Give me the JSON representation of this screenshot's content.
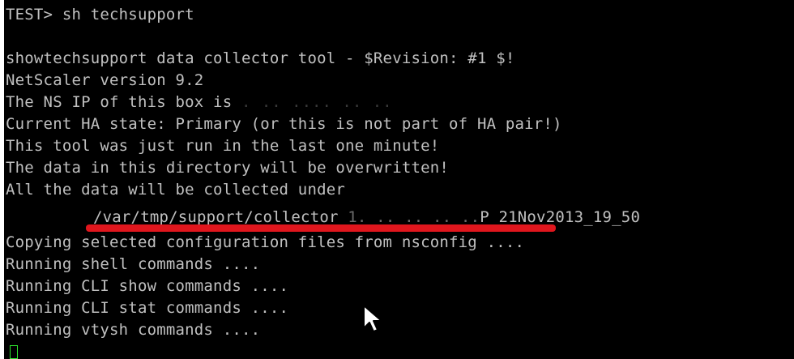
{
  "terminal": {
    "prompt_line": "TEST> sh techsupport",
    "lines": {
      "revision": "showtechsupport data collector tool - $Revision: #1 $!",
      "version": "NetScaler version 9.2",
      "ns_ip_prefix": "The NS IP of this box is ",
      "ns_ip_redacted": ". .. .... .. ..",
      "ha_state": "Current HA state: Primary (or this is not part of HA pair!)",
      "last_run": "This tool was just run in the last one minute!",
      "overwrite": "The data in this directory will be overwritten!",
      "collected_under": "All the data will be collected under",
      "path_prefix": "/var/tmp/support/collector_",
      "path_redacted": "1. .. .. .. ..",
      "path_suffix": "P_21Nov2013_19_50",
      "copying": "Copying selected configuration files from nsconfig ....",
      "shell": "Running shell commands ....",
      "cli_show": "Running CLI show commands ....",
      "cli_stat": "Running CLI stat commands ....",
      "vtysh": "Running vtysh commands ...."
    }
  },
  "colors": {
    "background": "#000000",
    "text": "#c0c0c0",
    "annotation_underline": "#e0161d",
    "cursor": "#2ee62e"
  },
  "icons": {
    "mouse_pointer": "arrow-cursor-icon",
    "terminal_cursor": "block-cursor-icon"
  }
}
